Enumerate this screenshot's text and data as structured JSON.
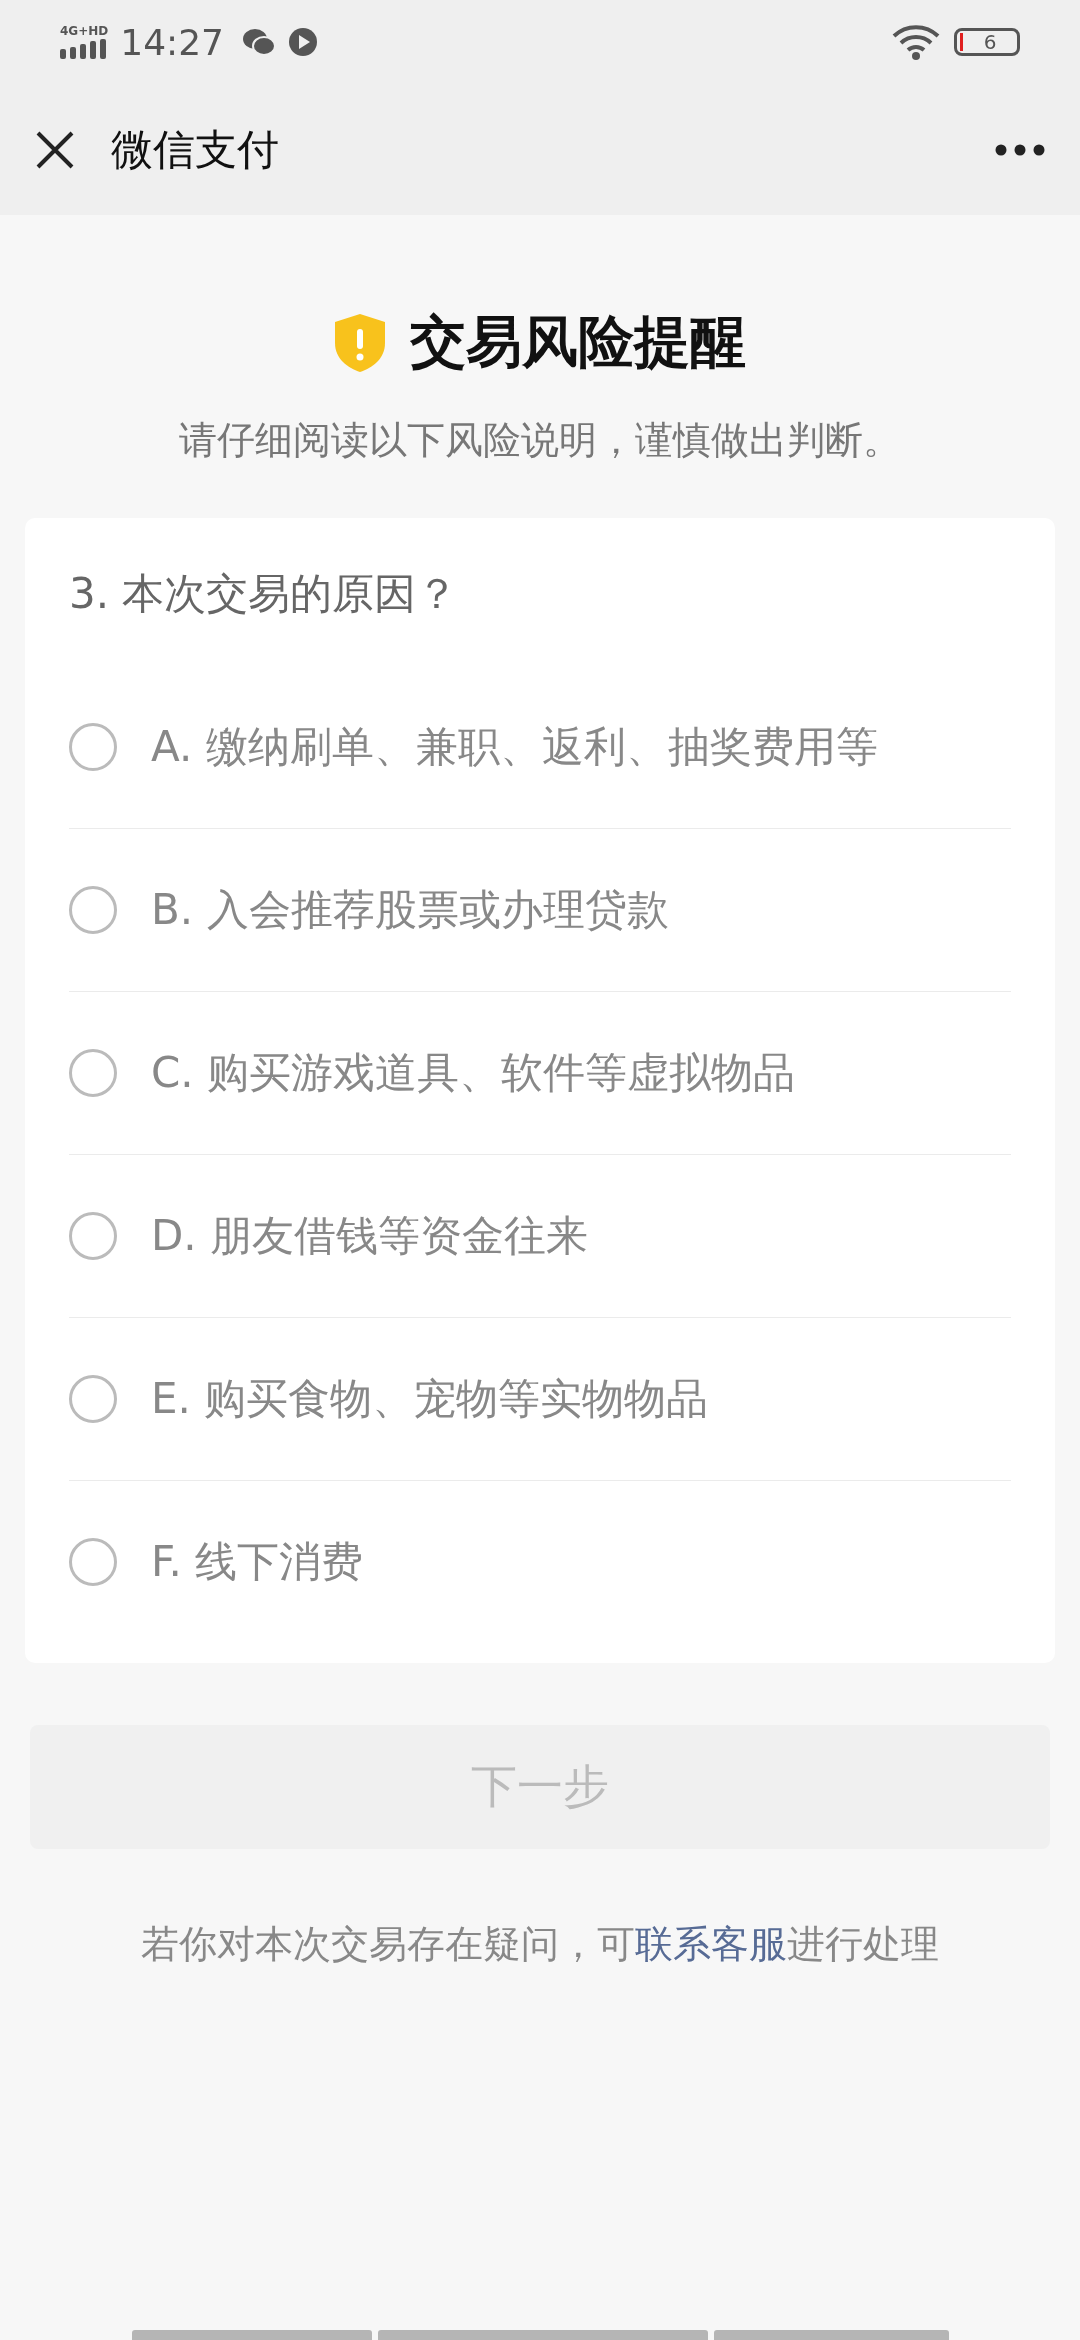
{
  "status_bar": {
    "network": "4G+HD",
    "time": "14:27",
    "battery": "6"
  },
  "nav": {
    "title": "微信支付"
  },
  "header": {
    "title": "交易风险提醒",
    "subtitle": "请仔细阅读以下风险说明，谨慎做出判断。"
  },
  "question": {
    "title": "3. 本次交易的原因？",
    "options": [
      {
        "label": "A. 缴纳刷单、兼职、返利、抽奖费用等",
        "selected": false
      },
      {
        "label": "B. 入会推荐股票或办理贷款",
        "selected": false
      },
      {
        "label": "C. 购买游戏道具、软件等虚拟物品",
        "selected": false
      },
      {
        "label": "D. 朋友借钱等资金往来",
        "selected": false
      },
      {
        "label": "E. 购买食物、宠物等实物物品",
        "selected": false
      },
      {
        "label": "F. 线下消费",
        "selected": false
      }
    ]
  },
  "next_button": {
    "label": "下一步",
    "disabled": true
  },
  "footer": {
    "before": "若你对本次交易存在疑问，可",
    "link": "联系客服",
    "after": "进行处理"
  }
}
